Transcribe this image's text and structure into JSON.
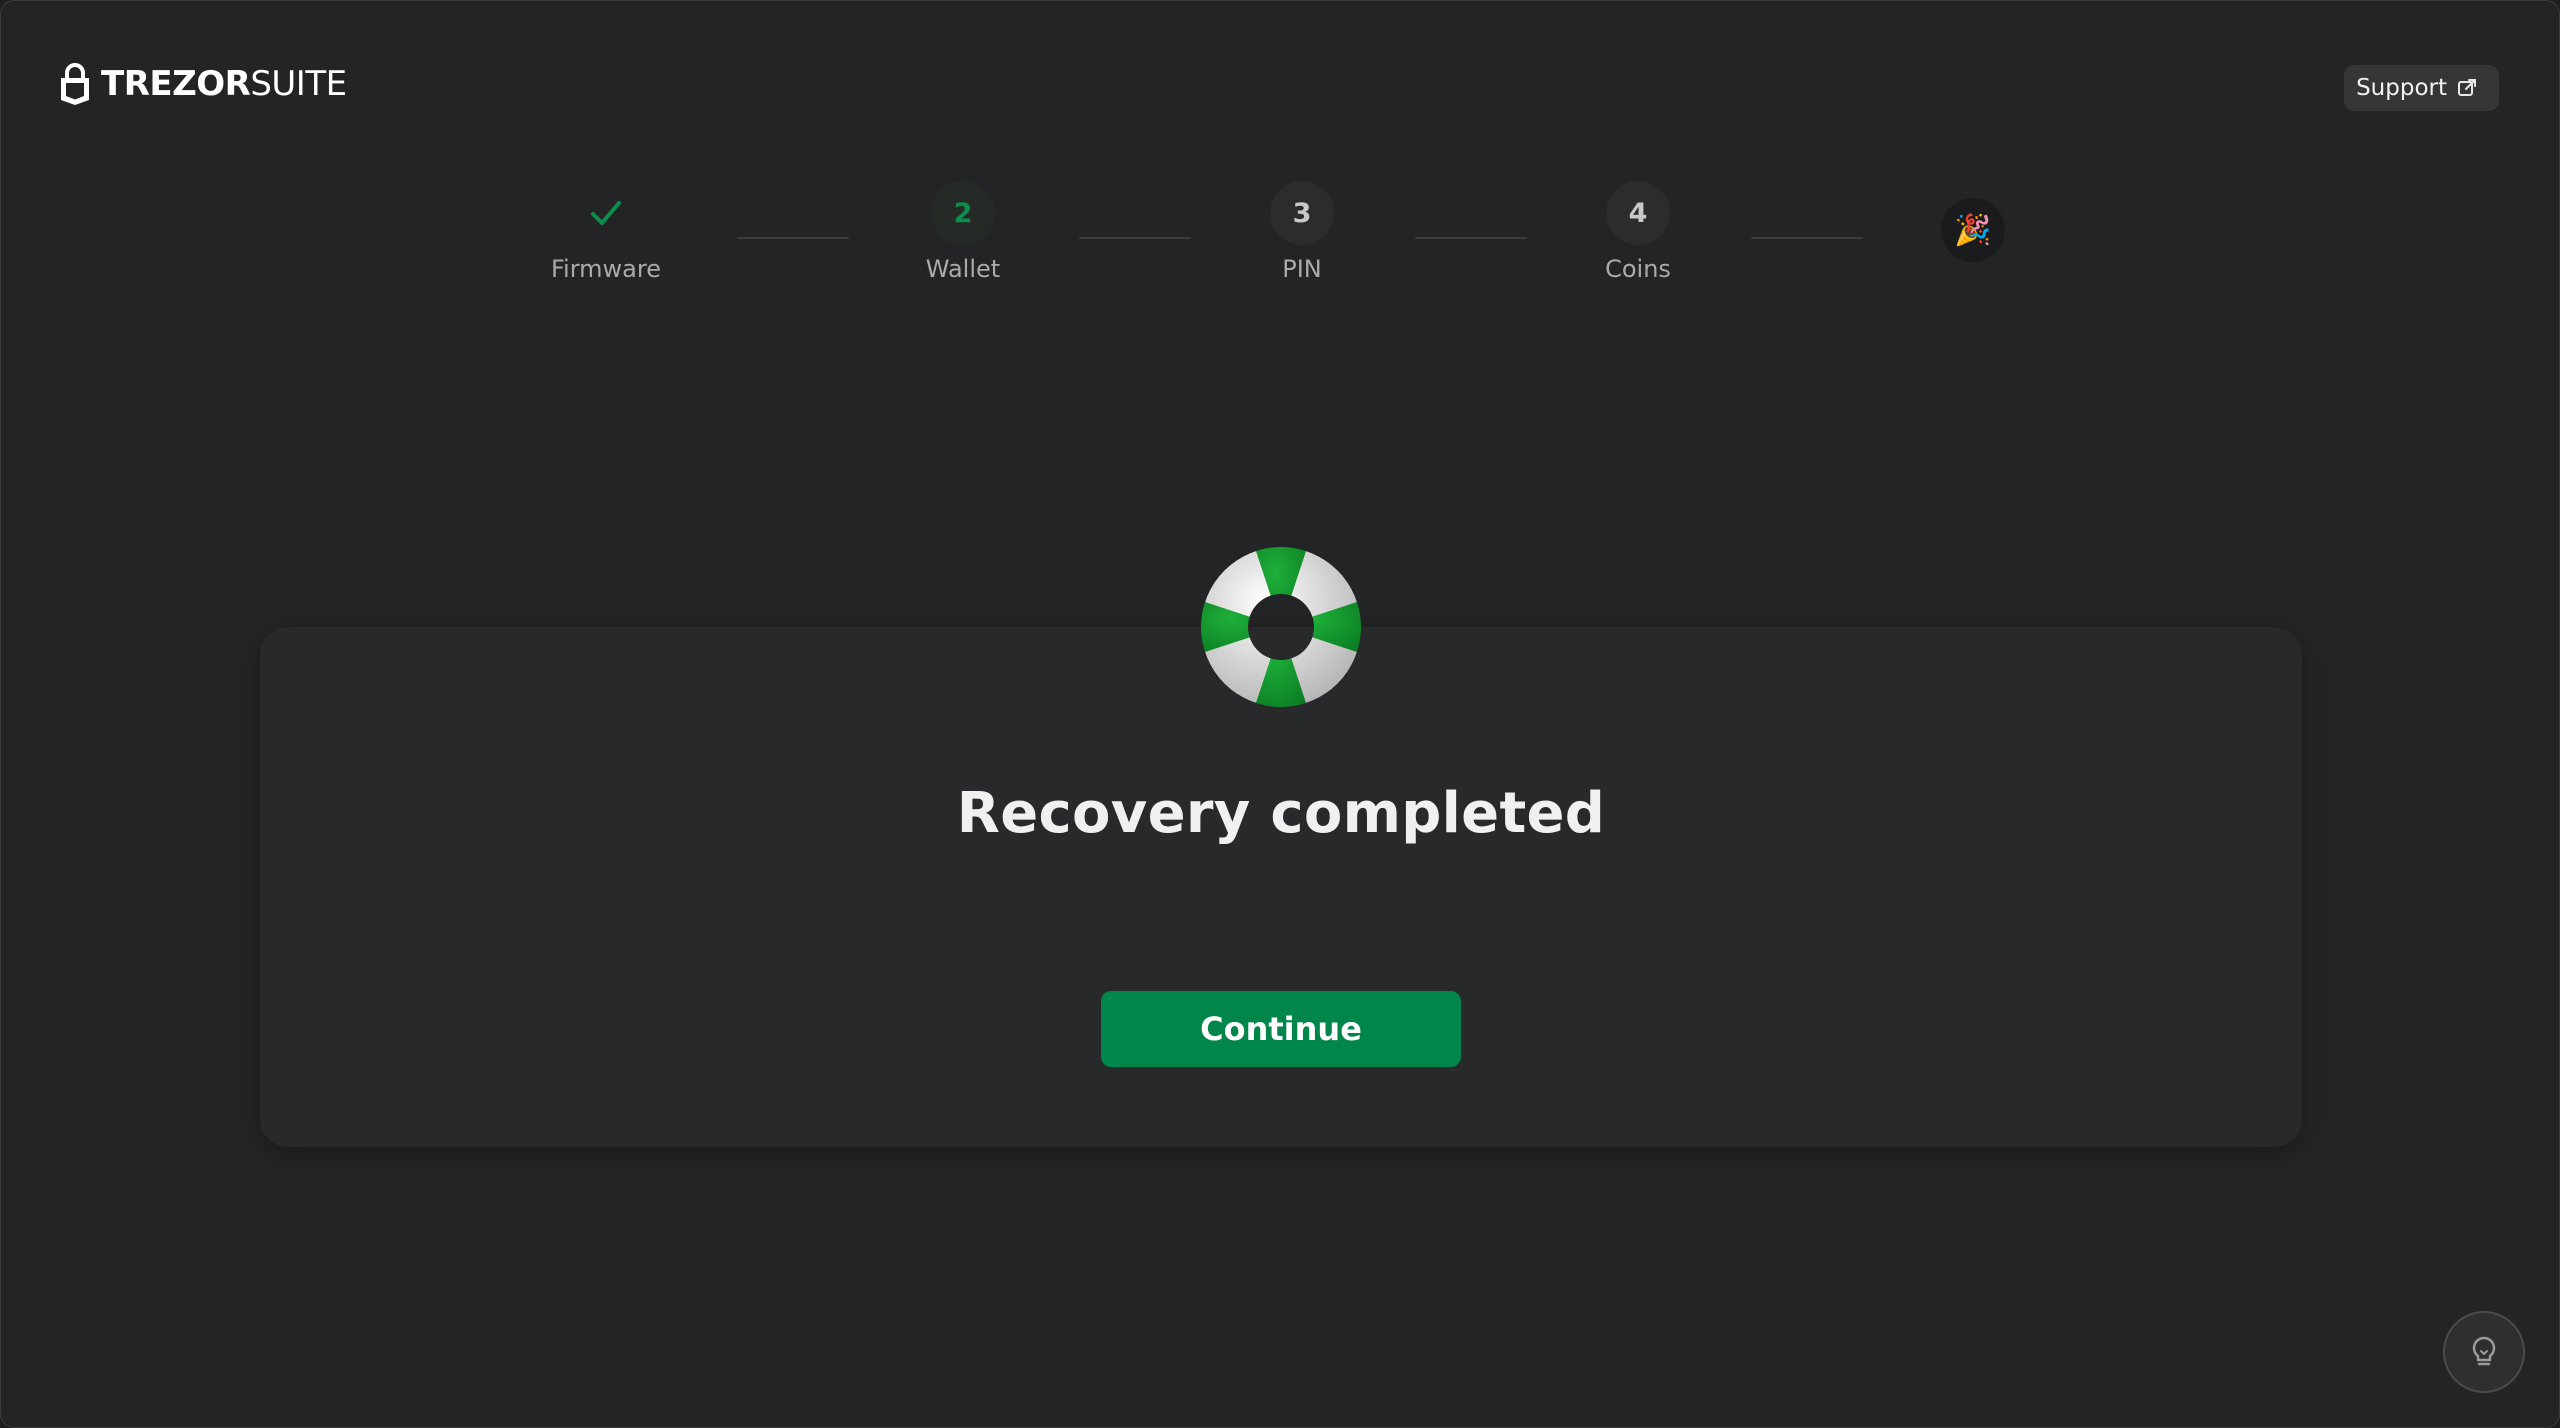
{
  "header": {
    "brand_bold": "TREZOR",
    "brand_light": "SUITE",
    "support_label": "Support"
  },
  "stepper": {
    "steps": [
      {
        "label": "Firmware",
        "marker": "✓",
        "state": "done"
      },
      {
        "label": "Wallet",
        "marker": "2",
        "state": "active"
      },
      {
        "label": "PIN",
        "marker": "3",
        "state": "pending"
      },
      {
        "label": "Coins",
        "marker": "4",
        "state": "pending"
      }
    ],
    "final_icon": "party-popper-icon"
  },
  "main": {
    "illustration": "lifebuoy-icon",
    "title": "Recovery completed",
    "continue_label": "Continue"
  },
  "colors": {
    "accent_green": "#00854a",
    "background": "#232425",
    "card": "#28292b"
  }
}
